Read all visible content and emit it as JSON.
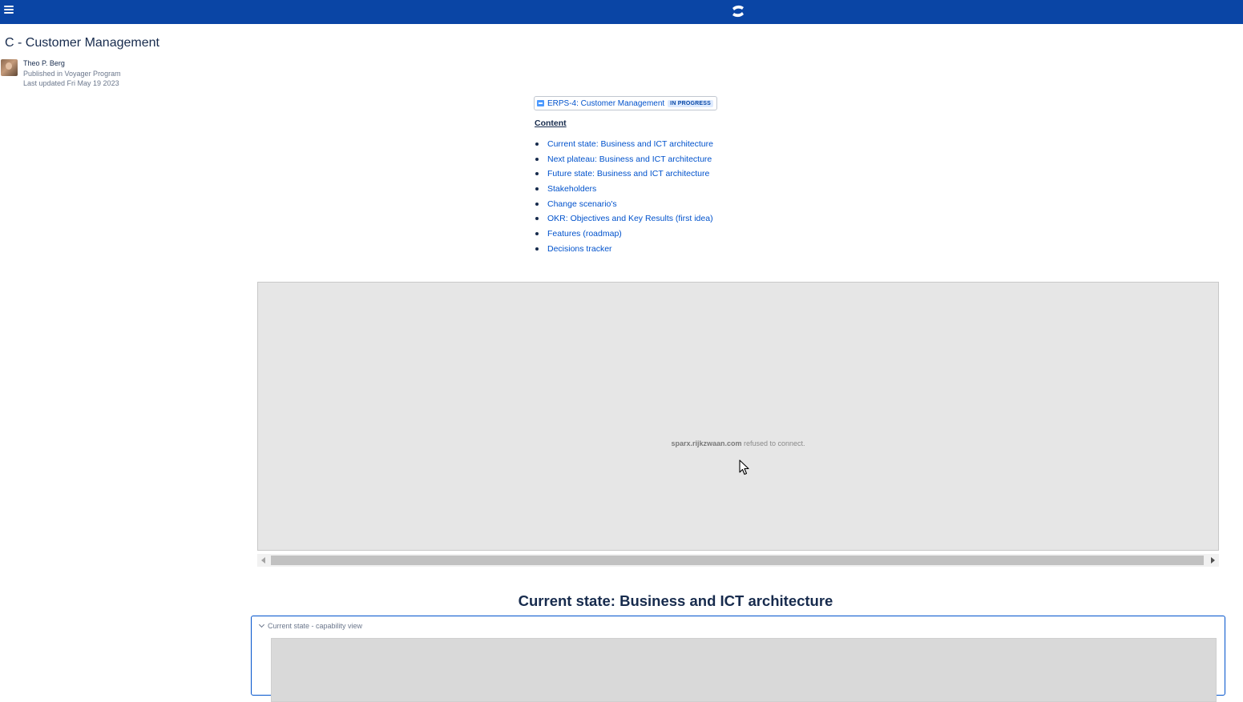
{
  "header": {
    "menu_icon": "hamburger-menu-icon",
    "logo_icon": "confluence-logo-icon",
    "bar_color": "#0a45a5"
  },
  "page": {
    "title": "C - Customer Management",
    "author": "Theo P. Berg",
    "published": "Published in Voyager Program",
    "updated": "Last updated Fri May 19 2023"
  },
  "jira": {
    "issue_label": "ERPS-4: Customer Management",
    "status": "IN PROGRESS"
  },
  "toc": {
    "heading": "Content",
    "items": [
      "Current state: Business and ICT architecture",
      "Next plateau: Business and ICT architecture",
      "Future state: Business and ICT architecture",
      "Stakeholders",
      "Change scenario's",
      "OKR: Objectives and Key Results (first idea)",
      "Features (roadmap)",
      "Decisions tracker"
    ]
  },
  "embed": {
    "host": "sparx.rijkzwaan.com",
    "message": " refused to connect."
  },
  "section": {
    "heading": "Current state: Business and ICT architecture",
    "expand_label": "Current state - capability view"
  }
}
